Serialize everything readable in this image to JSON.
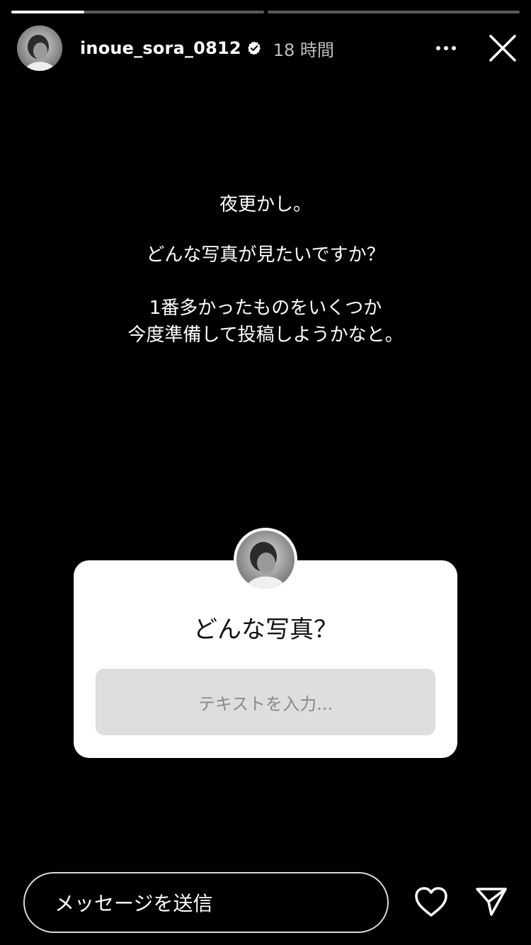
{
  "story": {
    "progress": [
      0.29,
      0
    ],
    "username": "inoue_sora_0812",
    "verified": true,
    "timestamp": "18 時間",
    "text_lines": [
      "夜更かし。",
      "どんな写真が見たいですか？",
      "1番多かったものをいくつか",
      "今度準備して投稿しようかなと。"
    ]
  },
  "sticker": {
    "question": "どんな写真？",
    "input_placeholder": "テキストを入力..."
  },
  "footer": {
    "message_placeholder": "メッセージを送信"
  },
  "icons": {
    "verified": "verified-badge-icon",
    "more": "more-horizontal-icon",
    "close": "close-icon",
    "heart": "heart-icon",
    "send": "send-icon"
  },
  "colors": {
    "background": "#000000",
    "sticker_bg": "#ffffff",
    "sticker_input_bg": "#dedede"
  }
}
